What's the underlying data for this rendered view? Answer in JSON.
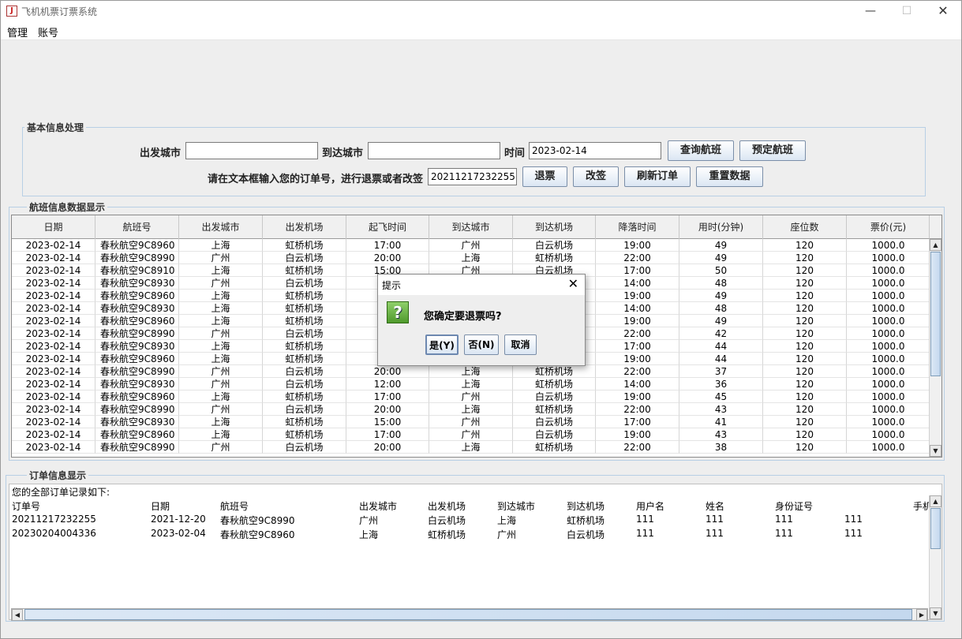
{
  "window": {
    "title": "飞机机票订票系统",
    "min": "—",
    "max": "☐",
    "close": "✕"
  },
  "menu": [
    "管理",
    "账号"
  ],
  "basic": {
    "group_title": "基本信息处理",
    "depart_label": "出发城市",
    "depart_value": "",
    "arrive_label": "到达城市",
    "arrive_value": "",
    "time_label": "时间",
    "time_value": "2023-02-14",
    "query_btn": "查询航班",
    "book_btn": "预定航班",
    "order_prompt": "请在文本框输入您的订单号，进行退票或者改签",
    "order_value": "20211217232255",
    "refund_btn": "退票",
    "change_btn": "改签",
    "refresh_btn": "刷新订单",
    "reset_btn": "重置数据"
  },
  "flights": {
    "group_title": "航班信息数据显示",
    "columns": [
      "日期",
      "航班号",
      "出发城市",
      "出发机场",
      "起飞时间",
      "到达城市",
      "到达机场",
      "降落时间",
      "用时(分钟)",
      "座位数",
      "票价(元)"
    ],
    "rows": [
      [
        "2023-02-14",
        "春秋航空9C8960",
        "上海",
        "虹桥机场",
        "17:00",
        "广州",
        "白云机场",
        "19:00",
        "49",
        "120",
        "1000.0"
      ],
      [
        "2023-02-14",
        "春秋航空9C8990",
        "广州",
        "白云机场",
        "20:00",
        "上海",
        "虹桥机场",
        "22:00",
        "49",
        "120",
        "1000.0"
      ],
      [
        "2023-02-14",
        "春秋航空9C8910",
        "上海",
        "虹桥机场",
        "15:00",
        "广州",
        "白云机场",
        "17:00",
        "50",
        "120",
        "1000.0"
      ],
      [
        "2023-02-14",
        "春秋航空9C8930",
        "广州",
        "白云机场",
        "",
        "",
        "",
        "14:00",
        "48",
        "120",
        "1000.0"
      ],
      [
        "2023-02-14",
        "春秋航空9C8960",
        "上海",
        "虹桥机场",
        "",
        "",
        "",
        "19:00",
        "49",
        "120",
        "1000.0"
      ],
      [
        "2023-02-14",
        "春秋航空9C8930",
        "上海",
        "虹桥机场",
        "",
        "",
        "",
        "14:00",
        "48",
        "120",
        "1000.0"
      ],
      [
        "2023-02-14",
        "春秋航空9C8960",
        "上海",
        "虹桥机场",
        "",
        "",
        "",
        "19:00",
        "49",
        "120",
        "1000.0"
      ],
      [
        "2023-02-14",
        "春秋航空9C8990",
        "广州",
        "白云机场",
        "2",
        "",
        "",
        "22:00",
        "42",
        "120",
        "1000.0"
      ],
      [
        "2023-02-14",
        "春秋航空9C8930",
        "上海",
        "虹桥机场",
        "",
        "",
        "",
        "17:00",
        "44",
        "120",
        "1000.0"
      ],
      [
        "2023-02-14",
        "春秋航空9C8960",
        "上海",
        "虹桥机场",
        "",
        "",
        "",
        "19:00",
        "44",
        "120",
        "1000.0"
      ],
      [
        "2023-02-14",
        "春秋航空9C8990",
        "广州",
        "白云机场",
        "20:00",
        "上海",
        "虹桥机场",
        "22:00",
        "37",
        "120",
        "1000.0"
      ],
      [
        "2023-02-14",
        "春秋航空9C8930",
        "广州",
        "白云机场",
        "12:00",
        "上海",
        "虹桥机场",
        "14:00",
        "36",
        "120",
        "1000.0"
      ],
      [
        "2023-02-14",
        "春秋航空9C8960",
        "上海",
        "虹桥机场",
        "17:00",
        "广州",
        "白云机场",
        "19:00",
        "45",
        "120",
        "1000.0"
      ],
      [
        "2023-02-14",
        "春秋航空9C8990",
        "广州",
        "白云机场",
        "20:00",
        "上海",
        "虹桥机场",
        "22:00",
        "43",
        "120",
        "1000.0"
      ],
      [
        "2023-02-14",
        "春秋航空9C8930",
        "上海",
        "虹桥机场",
        "15:00",
        "广州",
        "白云机场",
        "17:00",
        "41",
        "120",
        "1000.0"
      ],
      [
        "2023-02-14",
        "春秋航空9C8960",
        "上海",
        "虹桥机场",
        "17:00",
        "广州",
        "白云机场",
        "19:00",
        "43",
        "120",
        "1000.0"
      ],
      [
        "2023-02-14",
        "春秋航空9C8990",
        "广州",
        "白云机场",
        "20:00",
        "上海",
        "虹桥机场",
        "22:00",
        "38",
        "120",
        "1000.0"
      ]
    ]
  },
  "orders": {
    "group_title": "订单信息显示",
    "intro": "您的全部订单记录如下:",
    "headers": [
      "订单号",
      "日期",
      "航班号",
      "出发城市",
      "出发机场",
      "到达城市",
      "到达机场",
      "用户名",
      "姓名",
      "身份证号",
      "",
      "手机"
    ],
    "rows": [
      [
        "20211217232255",
        "2021-12-20",
        "春秋航空9C8990",
        "广州",
        "白云机场",
        "上海",
        "虹桥机场",
        "111",
        "111",
        "111",
        "111",
        ""
      ],
      [
        "20230204004336",
        "2023-02-04",
        "春秋航空9C8960",
        "上海",
        "虹桥机场",
        "广州",
        "白云机场",
        "111",
        "111",
        "111",
        "111",
        ""
      ]
    ]
  },
  "dialog": {
    "title": "提示",
    "message": "您确定要退票吗?",
    "yes": "是(Y)",
    "no": "否(N)",
    "cancel": "取消"
  }
}
